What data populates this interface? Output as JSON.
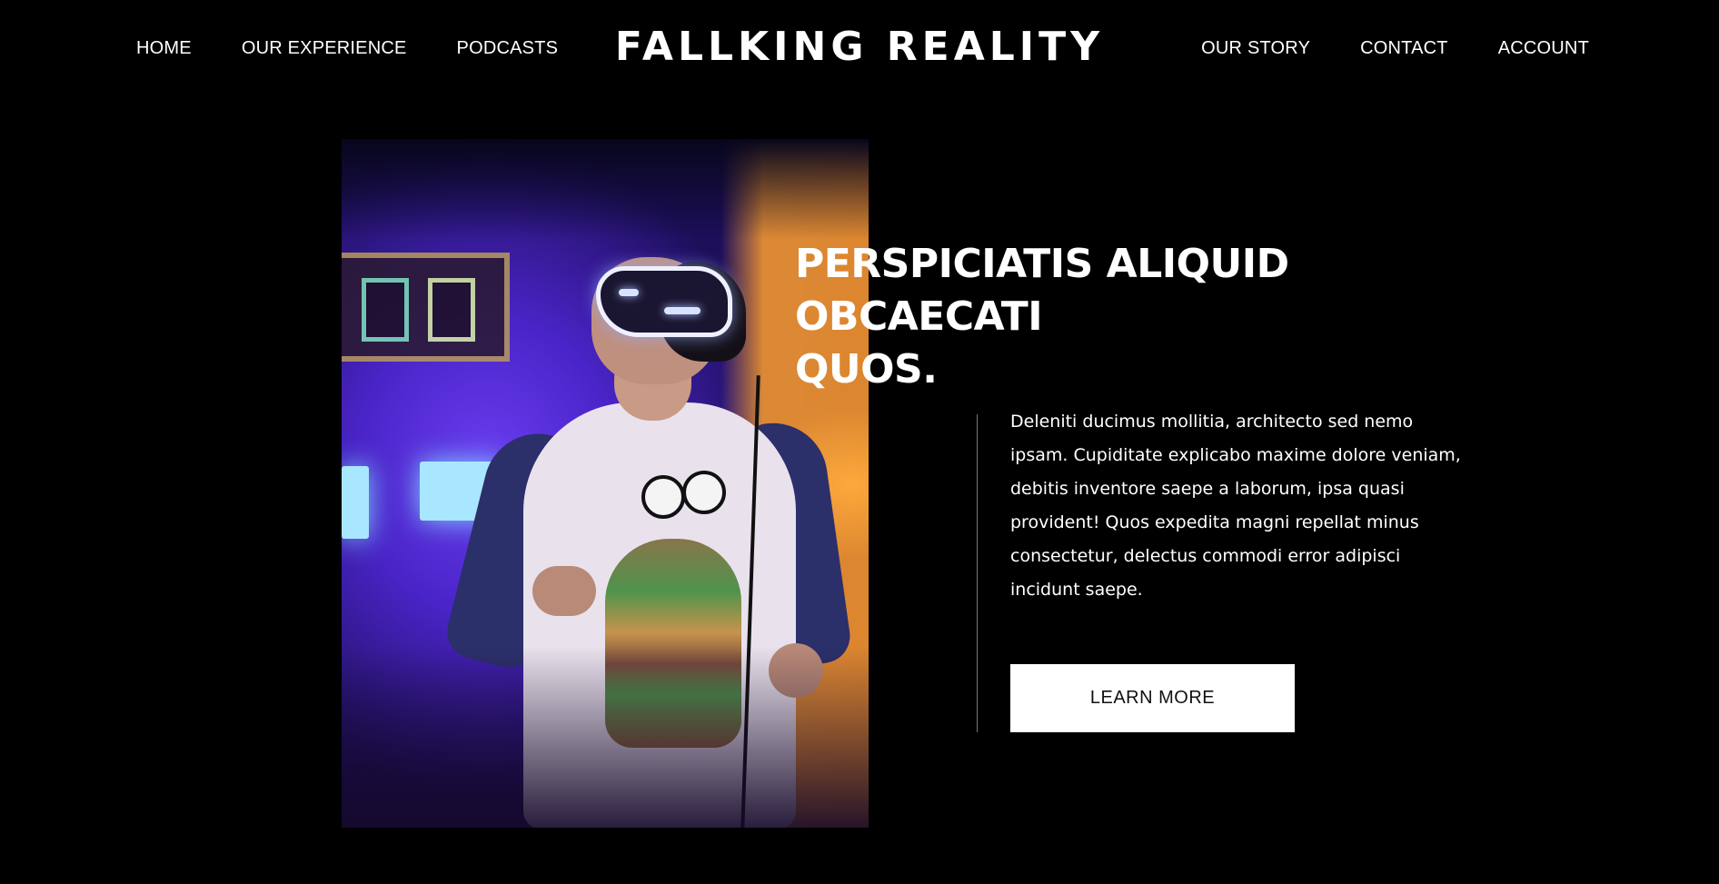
{
  "header": {
    "logo": "FALLKING REALITY",
    "nav_left": [
      "HOME",
      "OUR EXPERIENCE",
      "PODCASTS"
    ],
    "nav_right": [
      "OUR STORY",
      "CONTACT",
      "ACCOUNT"
    ]
  },
  "hero": {
    "headline_line1": "PERSPICIATIS ALIQUID OBCAECATI",
    "headline_line2": "QUOS.",
    "body": "Deleniti ducimus mollitia, architecto sed nemo ipsam. Cupiditate explicabo maxime dolore veniam, debitis inventore saepe a laborum, ipsa quasi provident! Quos expedita magni repellat minus consectetur, delectus commodi error adipisci incidunt saepe.",
    "cta_label": "LEARN MORE"
  },
  "colors": {
    "background": "#000000",
    "text": "#ffffff",
    "button_bg": "#ffffff",
    "button_text": "#111111",
    "divider": "#777777"
  }
}
